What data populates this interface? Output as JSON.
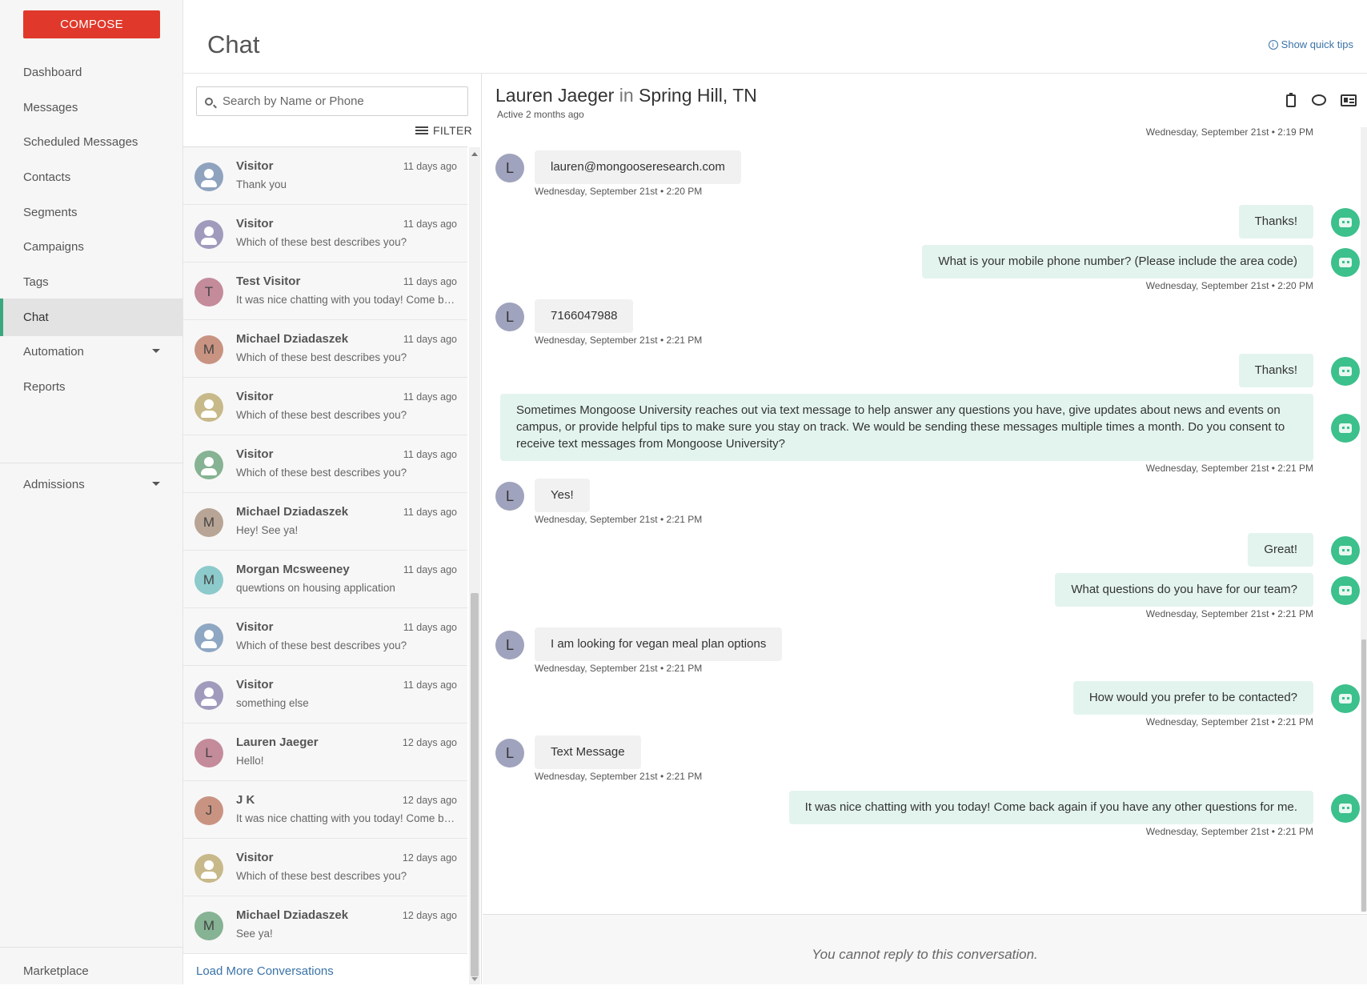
{
  "sidebar": {
    "compose_label": "COMPOSE",
    "items": [
      {
        "label": "Dashboard"
      },
      {
        "label": "Messages"
      },
      {
        "label": "Scheduled Messages"
      },
      {
        "label": "Contacts"
      },
      {
        "label": "Segments"
      },
      {
        "label": "Campaigns"
      },
      {
        "label": "Tags"
      },
      {
        "label": "Chat",
        "active": true
      },
      {
        "label": "Automation",
        "has_caret": true
      },
      {
        "label": "Reports"
      }
    ],
    "admissions_label": "Admissions",
    "marketplace_label": "Marketplace"
  },
  "header": {
    "title": "Chat",
    "quick_tips": "Show quick tips"
  },
  "list": {
    "search_placeholder": "Search by Name or Phone",
    "filter_label": "FILTER",
    "load_more": "Load More Conversations",
    "conversations": [
      {
        "name": "Visitor",
        "time": "11 days ago",
        "preview": "Thank you",
        "initial": "",
        "color": "#8fa3bf"
      },
      {
        "name": "Visitor",
        "time": "11 days ago",
        "preview": "Which of these best describes you?",
        "initial": "",
        "color": "#a09bbd"
      },
      {
        "name": "Test Visitor",
        "time": "11 days ago",
        "preview": "It was nice chatting with you today! Come back again if you have any other questions for me.",
        "initial": "T",
        "color": "#c48b9b"
      },
      {
        "name": "Michael Dziadaszek",
        "time": "11 days ago",
        "preview": "Which of these best describes you?",
        "initial": "M",
        "color": "#c99382"
      },
      {
        "name": "Visitor",
        "time": "11 days ago",
        "preview": "Which of these best describes you?",
        "initial": "",
        "color": "#c8b98a"
      },
      {
        "name": "Visitor",
        "time": "11 days ago",
        "preview": "Which of these best describes you?",
        "initial": "",
        "color": "#86b393"
      },
      {
        "name": "Michael Dziadaszek",
        "time": "11 days ago",
        "preview": "Hey! See ya!",
        "initial": "M",
        "color": "#b8a596"
      },
      {
        "name": "Morgan Mcsweeney",
        "time": "11 days ago",
        "preview": "quewtions on housing application",
        "initial": "M",
        "color": "#8ccacb"
      },
      {
        "name": "Visitor",
        "time": "11 days ago",
        "preview": "Which of these best describes you?",
        "initial": "",
        "color": "#8ea7c3"
      },
      {
        "name": "Visitor",
        "time": "11 days ago",
        "preview": "something else",
        "initial": "",
        "color": "#a09bbd"
      },
      {
        "name": "Lauren Jaeger",
        "time": "12 days ago",
        "preview": "Hello!",
        "initial": "L",
        "color": "#c48b9b"
      },
      {
        "name": "J K",
        "time": "12 days ago",
        "preview": "It was nice chatting with you today! Come back again if you have any other questions for me.",
        "initial": "J",
        "color": "#c99382"
      },
      {
        "name": "Visitor",
        "time": "12 days ago",
        "preview": "Which of these best describes you?",
        "initial": "",
        "color": "#c8b98a"
      },
      {
        "name": "Michael Dziadaszek",
        "time": "12 days ago",
        "preview": "See ya!",
        "initial": "M",
        "color": "#86b393"
      }
    ]
  },
  "chat": {
    "contact_name": "Lauren Jaeger",
    "in_word": "in",
    "location": "Spring Hill, TN",
    "status": "Active 2 months ago",
    "top_timestamp": "Wednesday, September 21st • 2:19 PM",
    "no_reply": "You cannot reply to this conversation.",
    "messages": [
      {
        "dir": "in",
        "initial": "L",
        "text": "lauren@mongooseresearch.com",
        "ts": "Wednesday, September 21st • 2:20 PM"
      },
      {
        "dir": "out",
        "text": "Thanks!",
        "ts": ""
      },
      {
        "dir": "out",
        "text": "What is your mobile phone number? (Please include the area code)",
        "ts": "Wednesday, September 21st • 2:20 PM"
      },
      {
        "dir": "in",
        "initial": "L",
        "text": "7166047988",
        "ts": "Wednesday, September 21st • 2:21 PM"
      },
      {
        "dir": "out",
        "text": "Thanks!",
        "ts": ""
      },
      {
        "dir": "out",
        "text": "Sometimes Mongoose University reaches out via text message to help answer any questions you have, give updates about news and events on campus, or provide helpful tips to make sure you stay on track. We would be sending these messages multiple times a month. Do you consent to receive text messages from Mongoose University?",
        "ts": "Wednesday, September 21st • 2:21 PM"
      },
      {
        "dir": "in",
        "initial": "L",
        "text": "Yes!",
        "ts": "Wednesday, September 21st • 2:21 PM"
      },
      {
        "dir": "out",
        "text": "Great!",
        "ts": ""
      },
      {
        "dir": "out",
        "text": "What questions do you have for our team?",
        "ts": "Wednesday, September 21st • 2:21 PM"
      },
      {
        "dir": "in",
        "initial": "L",
        "text": "I am looking for vegan meal plan options",
        "ts": "Wednesday, September 21st • 2:21 PM"
      },
      {
        "dir": "out",
        "text": "How would you prefer to be contacted?",
        "ts": "Wednesday, September 21st • 2:21 PM"
      },
      {
        "dir": "in",
        "initial": "L",
        "text": "Text Message",
        "ts": "Wednesday, September 21st • 2:21 PM"
      },
      {
        "dir": "out",
        "text": "It was nice chatting with you today! Come back again if you have any other questions for me.",
        "ts": "Wednesday, September 21st • 2:21 PM"
      }
    ]
  }
}
